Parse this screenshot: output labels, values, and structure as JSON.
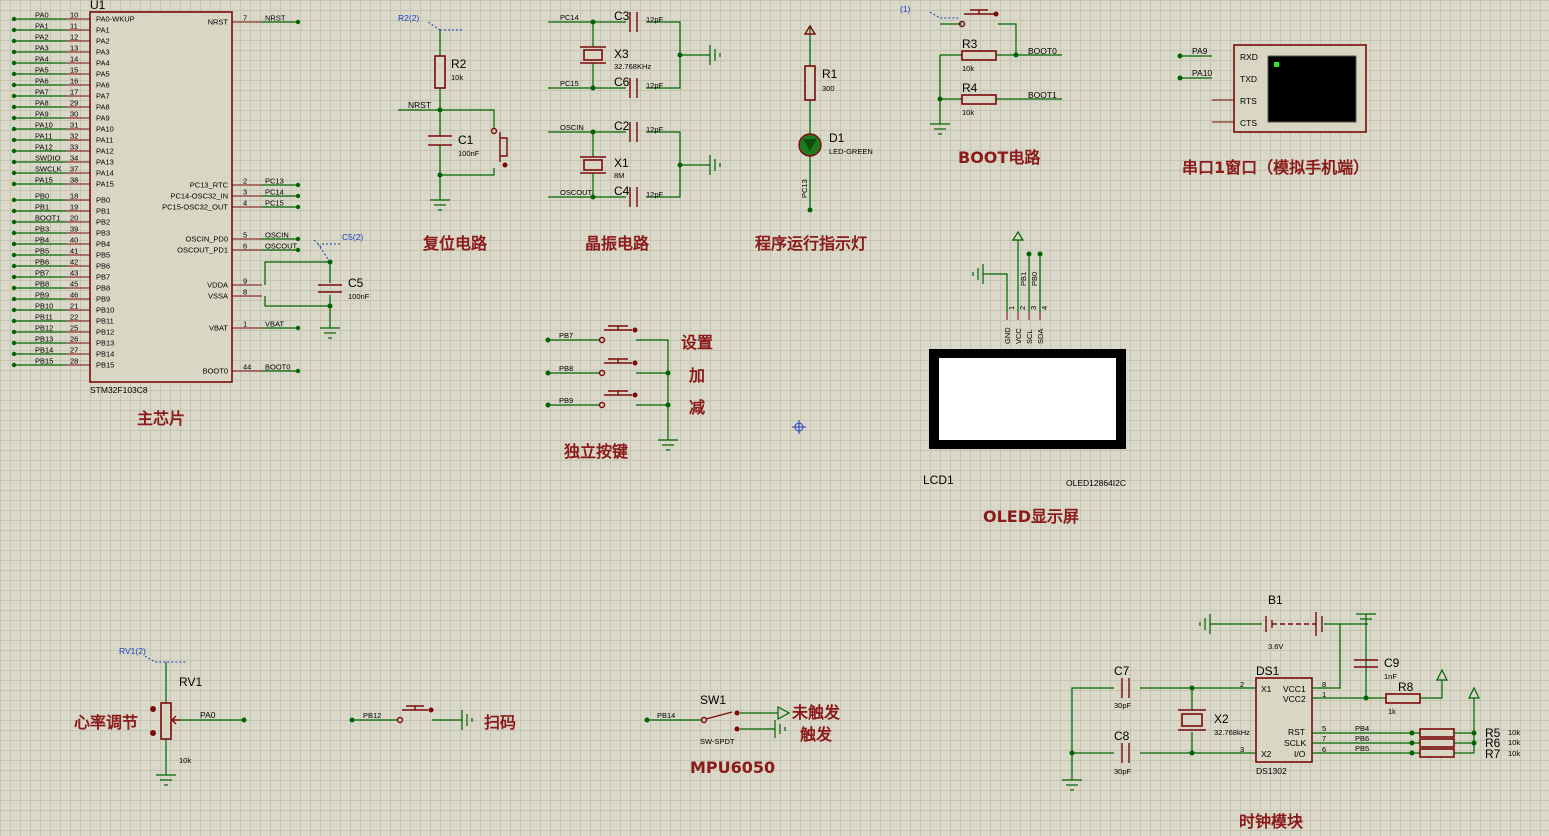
{
  "titles": {
    "main_chip": "主芯片",
    "reset": "复位电路",
    "crystal": "晶振电路",
    "indicator": "程序运行指示灯",
    "boot": "BOOT电路",
    "uart": "串口1窗口（模拟手机端）",
    "keys": "独立按键",
    "oled": "OLED显示屏",
    "heart": "心率调节",
    "scan": "扫码",
    "mpu": "MPU6050",
    "clock": "时钟模块"
  },
  "mcu": {
    "ref": "U1",
    "part": "STM32F103C8",
    "left_pins": [
      {
        "pin": "PA0-WKUP",
        "num": "10",
        "net": "PA0"
      },
      {
        "pin": "PA1",
        "num": "11",
        "net": "PA1"
      },
      {
        "pin": "PA2",
        "num": "12",
        "net": "PA2"
      },
      {
        "pin": "PA3",
        "num": "13",
        "net": "PA3"
      },
      {
        "pin": "PA4",
        "num": "14",
        "net": "PA4"
      },
      {
        "pin": "PA5",
        "num": "15",
        "net": "PA5"
      },
      {
        "pin": "PA6",
        "num": "16",
        "net": "PA6"
      },
      {
        "pin": "PA7",
        "num": "17",
        "net": "PA7"
      },
      {
        "pin": "PA8",
        "num": "29",
        "net": "PA8"
      },
      {
        "pin": "PA9",
        "num": "30",
        "net": "PA9"
      },
      {
        "pin": "PA10",
        "num": "31",
        "net": "PA10"
      },
      {
        "pin": "PA11",
        "num": "32",
        "net": "PA11"
      },
      {
        "pin": "PA12",
        "num": "33",
        "net": "PA12"
      },
      {
        "pin": "PA13",
        "num": "34",
        "net": "SWDIO"
      },
      {
        "pin": "PA14",
        "num": "37",
        "net": "SWCLK"
      },
      {
        "pin": "PA15",
        "num": "38",
        "net": "PA15"
      },
      {
        "pin": "PB0",
        "num": "18",
        "net": "PB0"
      },
      {
        "pin": "PB1",
        "num": "19",
        "net": "PB1"
      },
      {
        "pin": "PB2",
        "num": "20",
        "net": "BOOT1"
      },
      {
        "pin": "PB3",
        "num": "39",
        "net": "PB3"
      },
      {
        "pin": "PB4",
        "num": "40",
        "net": "PB4"
      },
      {
        "pin": "PB5",
        "num": "41",
        "net": "PB5"
      },
      {
        "pin": "PB6",
        "num": "42",
        "net": "PB6"
      },
      {
        "pin": "PB7",
        "num": "43",
        "net": "PB7"
      },
      {
        "pin": "PB8",
        "num": "45",
        "net": "PB8"
      },
      {
        "pin": "PB9",
        "num": "46",
        "net": "PB9"
      },
      {
        "pin": "PB10",
        "num": "21",
        "net": "PB10"
      },
      {
        "pin": "PB11",
        "num": "22",
        "net": "PB11"
      },
      {
        "pin": "PB12",
        "num": "25",
        "net": "PB12"
      },
      {
        "pin": "PB13",
        "num": "26",
        "net": "PB13"
      },
      {
        "pin": "PB14",
        "num": "27",
        "net": "PB14"
      },
      {
        "pin": "PB15",
        "num": "28",
        "net": "PB15"
      }
    ],
    "right_pins": [
      {
        "pin": "NRST",
        "num": "7",
        "net": "NRST"
      },
      {
        "pin": "PC13_RTC",
        "num": "2",
        "net": "PC13"
      },
      {
        "pin": "PC14-OSC32_IN",
        "num": "3",
        "net": "PC14"
      },
      {
        "pin": "PC15-OSC32_OUT",
        "num": "4",
        "net": "PC15"
      },
      {
        "pin": "OSCIN_PD0",
        "num": "5",
        "net": "OSCIN"
      },
      {
        "pin": "OSCOUT_PD1",
        "num": "6",
        "net": "OSCOUT"
      },
      {
        "pin": "VDDA",
        "num": "9",
        "net": ""
      },
      {
        "pin": "VSSA",
        "num": "8",
        "net": ""
      },
      {
        "pin": "VBAT",
        "num": "1",
        "net": "VBAT"
      },
      {
        "pin": "BOOT0",
        "num": "44",
        "net": "BOOT0"
      }
    ],
    "c5": {
      "ref": "C5",
      "val": "100nF",
      "probe": "C5(2)"
    }
  },
  "reset": {
    "r_ref": "R2",
    "r_val": "10k",
    "c_ref": "C1",
    "c_val": "100nF",
    "net": "NRST",
    "probe": "R2(2)"
  },
  "crystal": {
    "x3": {
      "ref": "X3",
      "val": "32.768KHz"
    },
    "x1": {
      "ref": "X1",
      "val": "8M"
    },
    "c3": {
      "ref": "C3",
      "val": "12pF"
    },
    "c6": {
      "ref": "C6",
      "val": "12pF"
    },
    "c2": {
      "ref": "C2",
      "val": "12pF"
    },
    "c4": {
      "ref": "C4",
      "val": "12pF"
    },
    "nets": [
      "PC14",
      "PC15",
      "OSCIN",
      "OSCOUT"
    ]
  },
  "indicator": {
    "r_ref": "R1",
    "r_val": "300",
    "d_ref": "D1",
    "d_val": "LED-GREEN",
    "net": "PC13"
  },
  "boot": {
    "probe": "(1)",
    "r3_ref": "R3",
    "r3_val": "10k",
    "r4_ref": "R4",
    "r4_val": "10k",
    "net0": "BOOT0",
    "net1": "BOOT1"
  },
  "uart": {
    "nets": [
      "PA9",
      "PA10"
    ],
    "pins": [
      "RXD",
      "TXD",
      "RTS",
      "CTS"
    ]
  },
  "keys": {
    "nets": [
      "PB7",
      "PB8",
      "PB9"
    ],
    "labels": [
      "设置",
      "加",
      "减"
    ]
  },
  "oled": {
    "pin_nets": [
      "PB1",
      "PB0"
    ],
    "pins": [
      "GND",
      "VCC",
      "SCL",
      "SDA"
    ],
    "pin_nums": [
      "1",
      "2",
      "3",
      "4"
    ],
    "ref": "LCD1",
    "part": "OLED12864I2C"
  },
  "heart": {
    "probe": "RV1(2)",
    "ref": "RV1",
    "val": "10k",
    "net": "PA0"
  },
  "scan": {
    "net": "PB12"
  },
  "mpu": {
    "ref": "SW1",
    "part": "SW-SPDT",
    "net": "PB14",
    "state_off": "未触发",
    "state_on": "触发"
  },
  "clock": {
    "b1": {
      "ref": "B1",
      "val": "3.6V"
    },
    "c9": {
      "ref": "C9",
      "val": "1nF"
    },
    "r8": {
      "ref": "R8",
      "val": "1k"
    },
    "c7": {
      "ref": "C7",
      "val": "30pF"
    },
    "c8": {
      "ref": "C8",
      "val": "30pF"
    },
    "x2": {
      "ref": "X2",
      "val": "32.768kHz"
    },
    "ds1": {
      "ref": "DS1",
      "part": "DS1302"
    },
    "ds_pins": [
      {
        "pin": "X1",
        "num": "2"
      },
      {
        "pin": "X2",
        "num": "3"
      },
      {
        "pin": "VCC1",
        "num": "8"
      },
      {
        "pin": "VCC2",
        "num": "1"
      },
      {
        "pin": "RST",
        "num": "5"
      },
      {
        "pin": "SCLK",
        "num": "7"
      },
      {
        "pin": "I/O",
        "num": "6"
      }
    ],
    "nets": [
      "PB4",
      "PB6",
      "PB5"
    ],
    "pullups": [
      {
        "ref": "R5",
        "val": "10k"
      },
      {
        "ref": "R6",
        "val": "10k"
      },
      {
        "ref": "R7",
        "val": "10k"
      }
    ]
  },
  "colors": {
    "wire": "#006400",
    "component": "#7a0a0a",
    "title": "#8b1a1a",
    "background": "#dad8c9",
    "probe": "#1a3fc0"
  }
}
